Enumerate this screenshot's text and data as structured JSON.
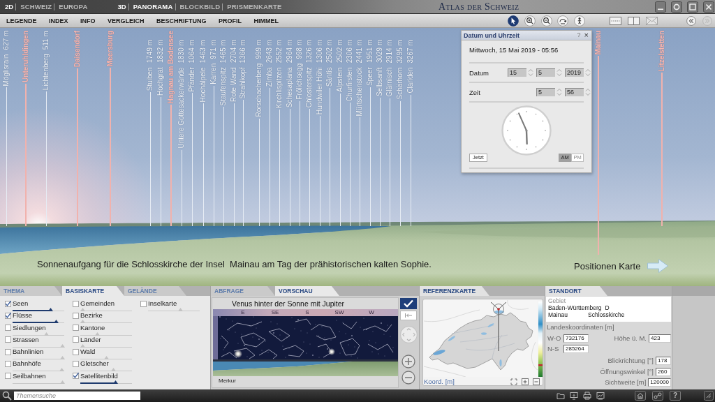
{
  "top_bar": {
    "mode_groups": [
      {
        "label": "2D",
        "items": [
          {
            "label": "SCHWEIZ",
            "selected": false
          },
          {
            "label": "EUROPA",
            "selected": false
          }
        ]
      },
      {
        "label": "3D",
        "items": [
          {
            "label": "PANORAMA",
            "selected": true
          },
          {
            "label": "BLOCKBILD",
            "selected": false
          },
          {
            "label": "PRISMENKARTE",
            "selected": false
          }
        ]
      }
    ],
    "title": "Atlas der Schweiz"
  },
  "menu": {
    "items": [
      "LEGENDE",
      "INDEX",
      "INFO",
      "VERGLEICH",
      "BESCHRIFTUNG",
      "PROFIL",
      "HIMMEL"
    ],
    "tools": [
      {
        "selected": true
      },
      {
        "selected": false
      },
      {
        "selected": false
      },
      {
        "selected": false
      },
      {
        "selected": false
      }
    ],
    "history": [
      {
        "disabled": false
      },
      {
        "disabled": true
      }
    ]
  },
  "panorama": {
    "labels": [
      {
        "name": "Möglisrain",
        "elevation": "627 m",
        "kind": "peak"
      },
      {
        "name": "Unteruhldingen",
        "kind": "place"
      },
      {
        "name": "Lichtenberg",
        "elevation": "511 m",
        "kind": "peak"
      },
      {
        "name": "Daisendorf",
        "kind": "place"
      },
      {
        "name": "Meersburg",
        "kind": "place"
      },
      {
        "name": "Stuiben",
        "elevation": "1749 m",
        "kind": "peak"
      },
      {
        "name": "Hochgrat",
        "elevation": "1832 m",
        "kind": "peak"
      },
      {
        "name": "Hagnau am Bodensee",
        "kind": "place"
      },
      {
        "name": "Untere Gottesackerwände",
        "elevation": "1830 m",
        "kind": "peak"
      },
      {
        "name": "Pfänder",
        "elevation": "1064 m",
        "kind": "peak"
      },
      {
        "name": "Hochälpele",
        "elevation": "1463 m",
        "kind": "peak"
      },
      {
        "name": "Karren",
        "elevation": "971 m",
        "kind": "peak"
      },
      {
        "name": "Staufenspitz",
        "elevation": "1465 m",
        "kind": "peak"
      },
      {
        "name": "Rote Wand",
        "elevation": "2704 m",
        "kind": "peak"
      },
      {
        "name": "Strahlkopf",
        "elevation": "1366 m",
        "kind": "peak"
      },
      {
        "name": "Rorschacherberg",
        "elevation": "999 m",
        "kind": "peak"
      },
      {
        "name": "Zimba",
        "elevation": "2643 m",
        "kind": "peak"
      },
      {
        "name": "Kirchlispitzen",
        "elevation": "2552 m",
        "kind": "peak"
      },
      {
        "name": "Schesaplana",
        "elevation": "2964 m",
        "kind": "peak"
      },
      {
        "name": "Frölichsegg",
        "elevation": "998 m",
        "kind": "peak"
      },
      {
        "name": "Chlosterspitz",
        "elevation": "1326 m",
        "kind": "peak"
      },
      {
        "name": "Hundwiler Höhi",
        "elevation": "1306 m",
        "kind": "peak"
      },
      {
        "name": "Säntis",
        "elevation": "2502 m",
        "kind": "peak"
      },
      {
        "name": "Alpstein",
        "elevation": "2502 m",
        "kind": "peak"
      },
      {
        "name": "Churfirsten",
        "elevation": "2306 m",
        "kind": "peak"
      },
      {
        "name": "Mürtschenstock",
        "elevation": "2441 m",
        "kind": "peak"
      },
      {
        "name": "Speer",
        "elevation": "1951 m",
        "kind": "peak"
      },
      {
        "name": "Selbsanft",
        "elevation": "3029 m",
        "kind": "peak"
      },
      {
        "name": "Glärnisch",
        "elevation": "2914 m",
        "kind": "peak"
      },
      {
        "name": "Schärhorn",
        "elevation": "3295 m",
        "kind": "peak"
      },
      {
        "name": "Clariden",
        "elevation": "3267 m",
        "kind": "peak"
      },
      {
        "name": "Mainau",
        "kind": "place"
      },
      {
        "name": "Litzelstetten",
        "kind": "place"
      }
    ],
    "caption": "Sonnenaufgang für die Schlosskirche der Insel  Mainau am Tag der prähistorischen kalten Sophie.",
    "map_link": "Positionen Karte"
  },
  "datetime_dialog": {
    "title": "Datum und Uhrzeit",
    "help": "?",
    "close": "×",
    "summary": "Mittwoch, 15 Mai 2019 - 05:56",
    "date_label": "Datum",
    "date_fields": [
      "15",
      "5",
      "2019"
    ],
    "time_label": "Zeit",
    "time_fields": [
      "5",
      "56"
    ],
    "now_button": "Jetzt",
    "meridiem": [
      {
        "label": "AM",
        "selected": true
      },
      {
        "label": "PM",
        "selected": false
      }
    ]
  },
  "layer_panel": {
    "tabs": [
      {
        "label": "THEMA",
        "selected": false
      },
      {
        "label": "BASISKARTE",
        "selected": true
      },
      {
        "label": "GELÄNDE",
        "selected": false
      }
    ],
    "columns": [
      {
        "items": [
          {
            "label": "Seen",
            "checked": true,
            "level": 0.74
          },
          {
            "label": "Flüsse",
            "checked": true,
            "level": 0.84
          },
          {
            "label": "Siedlungen",
            "checked": false,
            "level": 0.66
          },
          {
            "label": "Strassen",
            "checked": false,
            "level": 0.97
          },
          {
            "label": "Bahnlinien",
            "checked": false,
            "level": 0.97
          },
          {
            "label": "Bahnhöfe",
            "checked": false,
            "level": 0.95
          },
          {
            "label": "Seilbahnen",
            "checked": false,
            "level": 0.97
          }
        ]
      },
      {
        "items": [
          {
            "label": "Gemeinden",
            "checked": false,
            "level": 0.05
          },
          {
            "label": "Bezirke",
            "checked": false,
            "level": 0.05
          },
          {
            "label": "Kantone",
            "checked": false,
            "level": 0.33
          },
          {
            "label": "Länder",
            "checked": false,
            "level": 0.05
          },
          {
            "label": "Wald",
            "checked": false,
            "level": 0.51
          },
          {
            "label": "Gletscher",
            "checked": false,
            "level": 0.64
          },
          {
            "label": "Satellitenbild",
            "checked": true,
            "level": 0.68
          }
        ]
      },
      {
        "items": [
          {
            "label": "Inselkarte",
            "checked": false,
            "level": 0.63
          }
        ]
      }
    ]
  },
  "preview_panel": {
    "tabs": [
      {
        "label": "ABFRAGE",
        "selected": false
      },
      {
        "label": "VORSCHAU",
        "selected": true
      }
    ],
    "title": "Venus hinter der Sonne mit Jupiter",
    "compass": [
      "E",
      "SE",
      "S",
      "SW",
      "W"
    ],
    "caption": "Merkur"
  },
  "reference_map": {
    "tab": "REFERENZKARTE",
    "coords_label": "Koord. [m]"
  },
  "location": {
    "tab": "STANDORT",
    "area_label": "Gebiet",
    "region": "Baden-Württemberg",
    "country": "D",
    "place": "Mainau",
    "site": "Schlosskirche",
    "coords_heading": "Landeskoordinaten [m]",
    "coords": [
      {
        "label": "W-O",
        "value": "732176"
      },
      {
        "label": "N-S",
        "value": "285264"
      }
    ],
    "altitude": {
      "label": "Höhe ü. M.",
      "value": "423"
    },
    "view": [
      {
        "label": "Blickrichtung [°]",
        "value": "178"
      },
      {
        "label": "Öffnungswinkel [°]",
        "value": "260"
      },
      {
        "label": "Sichtweite [m]",
        "value": "120000"
      }
    ]
  },
  "bottom_bar": {
    "search": {
      "placeholder": "Themensuche"
    },
    "help": "?"
  }
}
